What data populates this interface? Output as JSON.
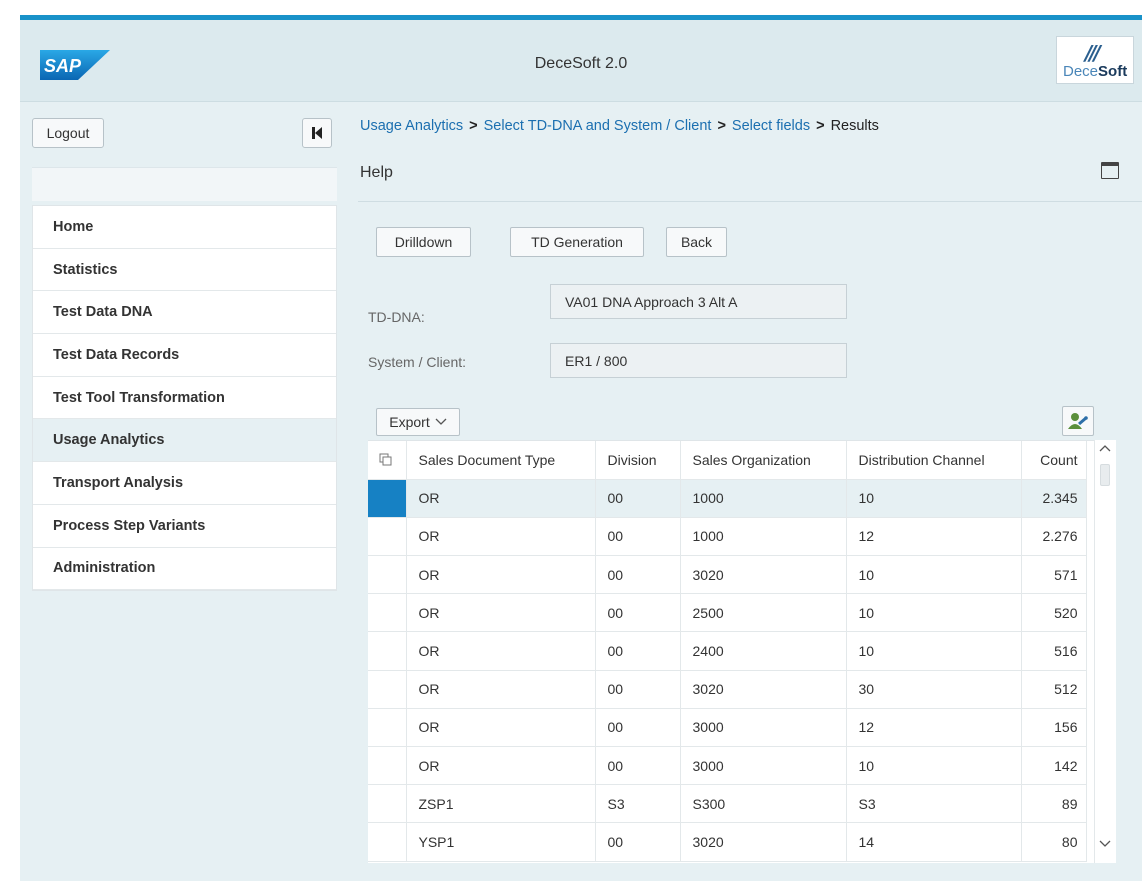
{
  "header": {
    "title": "DeceSoft 2.0",
    "sap_logo_text": "SAP",
    "decesoft_logo": {
      "stripes": "///",
      "part1": "Dece",
      "part2": "Soft"
    }
  },
  "sidebar": {
    "logout_label": "Logout",
    "collapse_icon": "skip-to-start-icon",
    "items": [
      {
        "label": "Home"
      },
      {
        "label": "Statistics"
      },
      {
        "label": "Test Data DNA"
      },
      {
        "label": "Test Data Records"
      },
      {
        "label": "Test Tool Transformation"
      },
      {
        "label": "Usage Analytics",
        "active": true
      },
      {
        "label": "Transport Analysis"
      },
      {
        "label": "Process Step Variants"
      },
      {
        "label": "Administration"
      }
    ]
  },
  "breadcrumb": {
    "items": [
      "Usage Analytics",
      "Select TD-DNA and System / Client",
      "Select fields"
    ],
    "current": "Results",
    "separator": ">"
  },
  "help_label": "Help",
  "actions": {
    "drilldown": "Drilldown",
    "td_generation": "TD Generation",
    "back": "Back"
  },
  "fields": {
    "tddna_label": "TD-DNA:",
    "tddna_value": "VA01 DNA Approach 3 Alt A",
    "system_label": "System / Client:",
    "system_value": "ER1 / 800"
  },
  "table": {
    "export_label": "Export",
    "columns": [
      "Sales Document Type",
      "Division",
      "Sales Organization",
      "Distribution Channel",
      "Count"
    ],
    "rows": [
      [
        "OR",
        "00",
        "1000",
        "10",
        "2.345"
      ],
      [
        "OR",
        "00",
        "1000",
        "12",
        "2.276"
      ],
      [
        "OR",
        "00",
        "3020",
        "10",
        "571"
      ],
      [
        "OR",
        "00",
        "2500",
        "10",
        "520"
      ],
      [
        "OR",
        "00",
        "2400",
        "10",
        "516"
      ],
      [
        "OR",
        "00",
        "3020",
        "30",
        "512"
      ],
      [
        "OR",
        "00",
        "3000",
        "12",
        "156"
      ],
      [
        "OR",
        "00",
        "3000",
        "10",
        "142"
      ],
      [
        "ZSP1",
        "S3",
        "S300",
        "S3",
        "89"
      ],
      [
        "YSP1",
        "00",
        "3020",
        "14",
        "80"
      ]
    ],
    "selected_row": 0
  },
  "colors": {
    "accent": "#1992c9",
    "link": "#1b6fb0",
    "selected": "#1681c4",
    "background": "#e6f0f3"
  }
}
